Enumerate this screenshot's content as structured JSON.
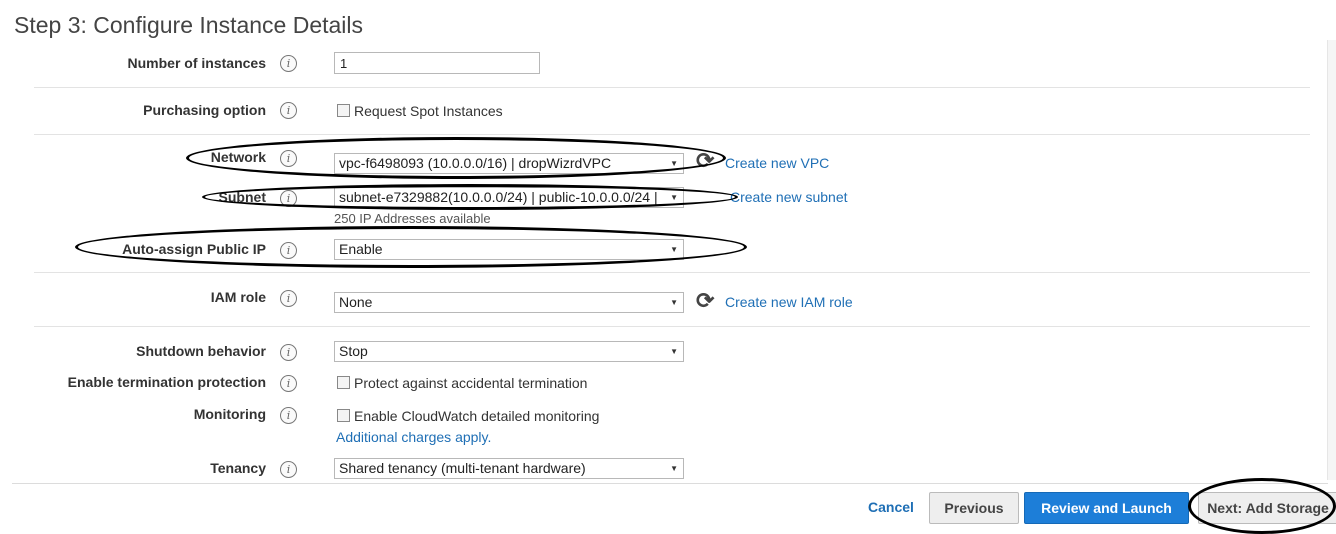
{
  "page": {
    "title": "Step 3: Configure Instance Details"
  },
  "fields": {
    "num_instances": {
      "label": "Number of instances",
      "value": "1"
    },
    "purchasing": {
      "label": "Purchasing option",
      "checkbox_label": "Request Spot Instances"
    },
    "network": {
      "label": "Network",
      "value": "vpc-f6498093 (10.0.0.0/16) | dropWizrdVPC",
      "link": "Create new VPC"
    },
    "subnet": {
      "label": "Subnet",
      "value": "subnet-e7329882(10.0.0.0/24) | public-10.0.0.0/24 |",
      "link": "Create new subnet",
      "subtext": "250 IP Addresses available"
    },
    "public_ip": {
      "label": "Auto-assign Public IP",
      "value": "Enable"
    },
    "iam_role": {
      "label": "IAM role",
      "value": "None",
      "link": "Create new IAM role"
    },
    "shutdown": {
      "label": "Shutdown behavior",
      "value": "Stop"
    },
    "termination": {
      "label": "Enable termination protection",
      "checkbox_label": "Protect against accidental termination"
    },
    "monitoring": {
      "label": "Monitoring",
      "checkbox_label": "Enable CloudWatch detailed monitoring",
      "link": "Additional charges apply."
    },
    "tenancy": {
      "label": "Tenancy",
      "value": "Shared tenancy (multi-tenant hardware)"
    }
  },
  "icons": {
    "info": "i",
    "refresh": "⟳",
    "caret": "▼"
  },
  "footer": {
    "cancel": "Cancel",
    "previous": "Previous",
    "review": "Review and Launch",
    "next": "Next: Add Storage"
  },
  "colors": {
    "link": "#1f6fb5",
    "primary_button": "#1d7ed8"
  }
}
